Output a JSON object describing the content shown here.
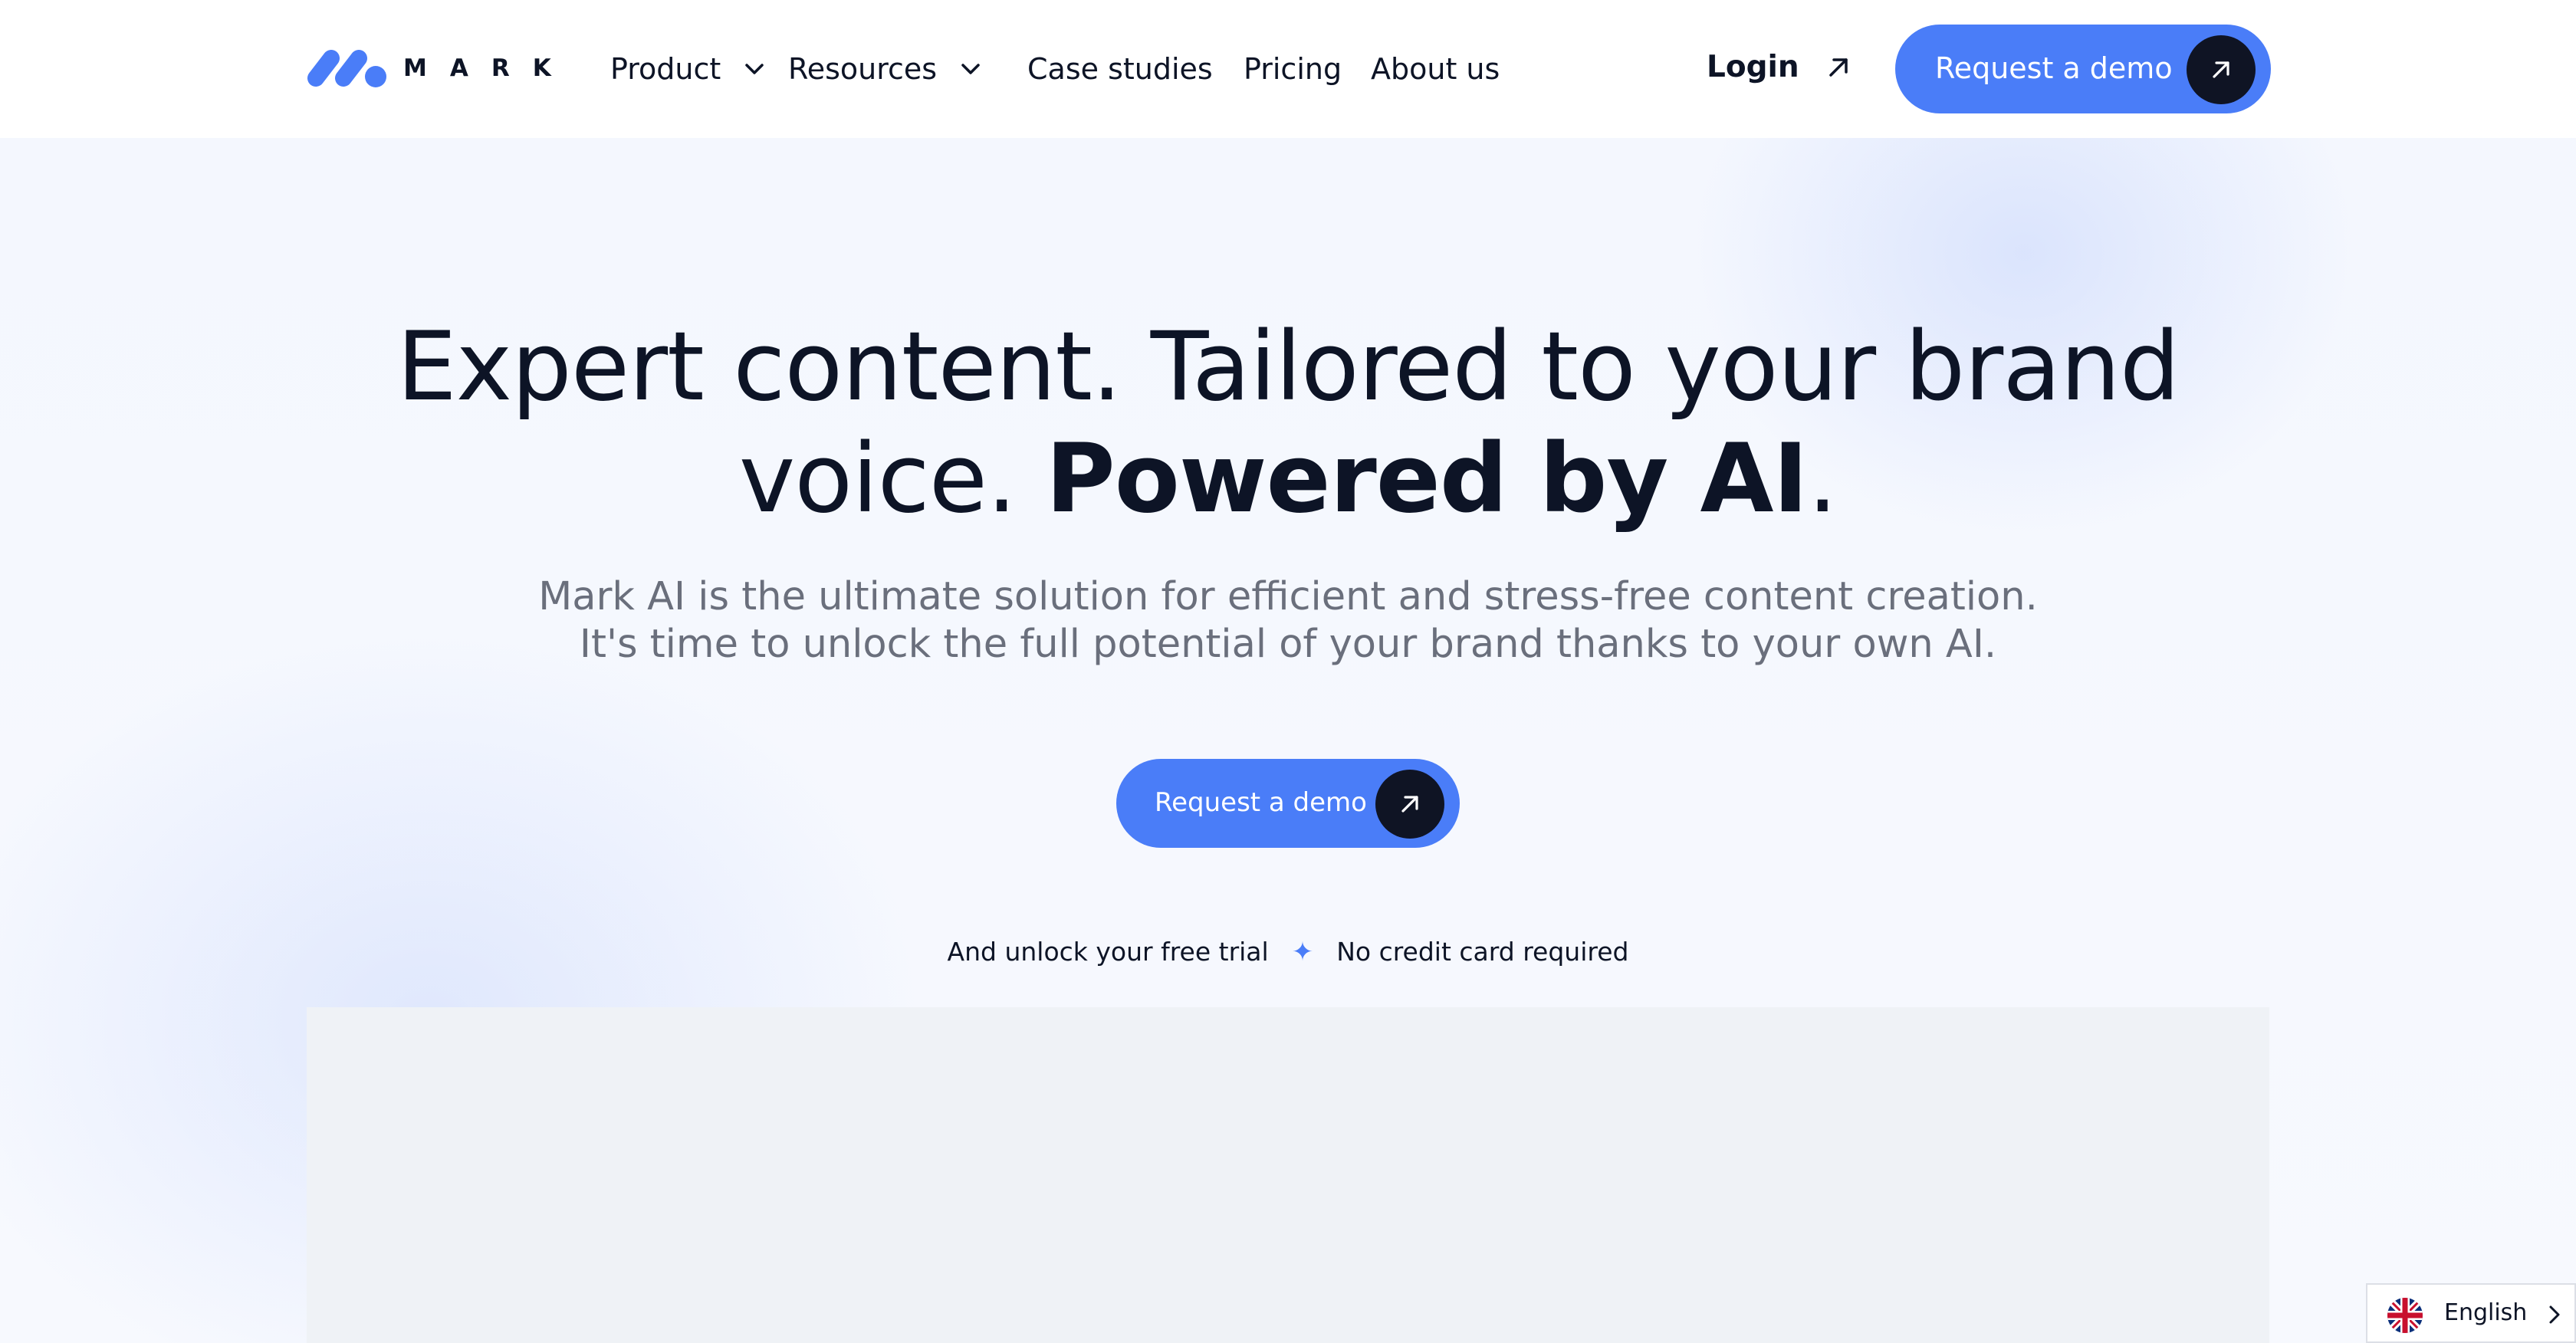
{
  "brand": {
    "name": "MARK",
    "accent": "#4a7df8",
    "dark": "#0f1424"
  },
  "nav": {
    "items": [
      {
        "label": "Product",
        "has_dropdown": true
      },
      {
        "label": "Resources",
        "has_dropdown": true
      },
      {
        "label": "Case studies",
        "has_dropdown": false
      },
      {
        "label": "Pricing",
        "has_dropdown": false
      },
      {
        "label": "About us",
        "has_dropdown": false
      }
    ],
    "login_label": "Login",
    "cta_label": "Request a demo"
  },
  "hero": {
    "headline_part1": "Expert content. Tailored to your brand voice. ",
    "headline_bold": "Powered by AI",
    "headline_end": ".",
    "subtitle_line1": "Mark AI is the ultimate solution for efficient and stress-free content creation.",
    "subtitle_line2": "It's time to unlock the full potential of your brand thanks to your own AI.",
    "cta_label": "Request a demo",
    "note_left": "And unlock your free trial",
    "note_separator": "✦",
    "note_right": "No credit card required"
  },
  "language": {
    "label": "English",
    "icon": "uk-flag-icon"
  }
}
